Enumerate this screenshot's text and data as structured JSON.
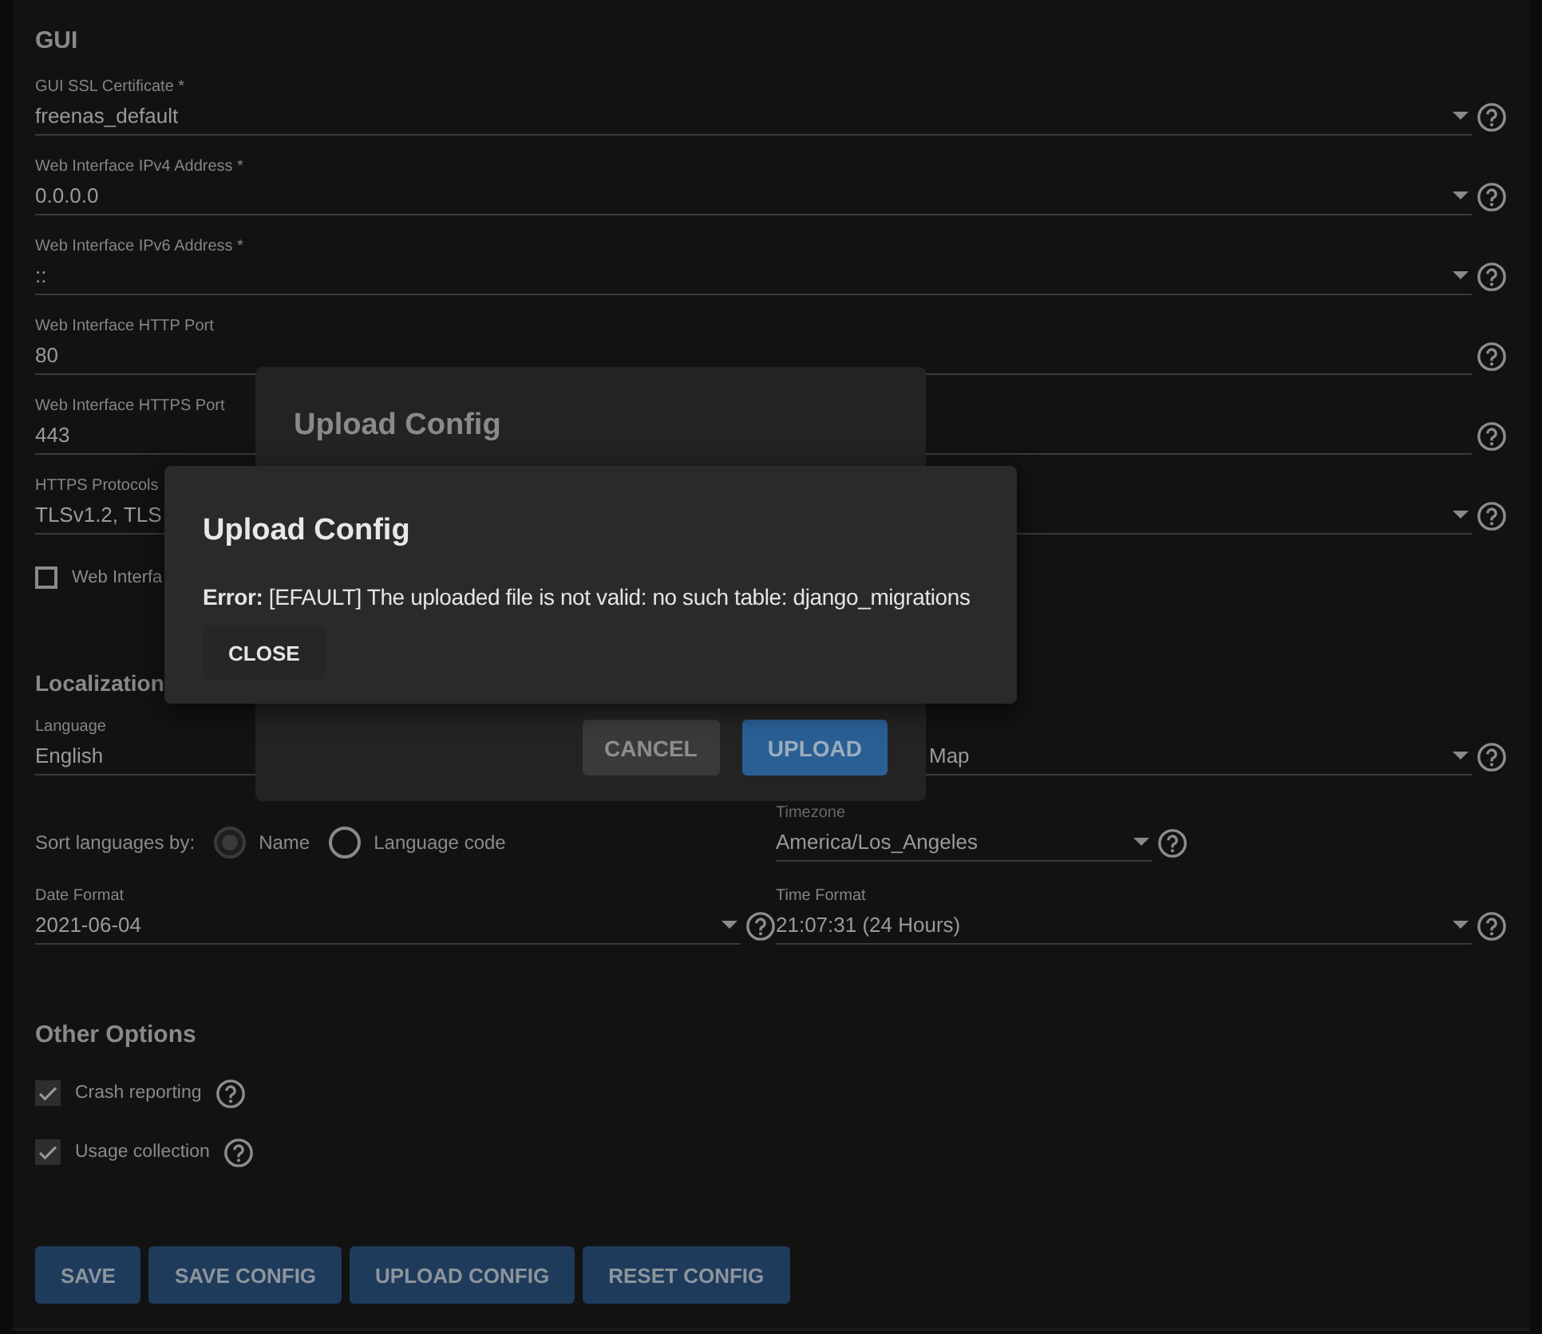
{
  "gui": {
    "title": "GUI",
    "fields": [
      {
        "kind": "select",
        "label": "GUI SSL Certificate *",
        "value": "freenas_default"
      },
      {
        "kind": "select",
        "label": "Web Interface IPv4 Address *",
        "value": "0.0.0.0"
      },
      {
        "kind": "select",
        "label": "Web Interface IPv6 Address *",
        "value": "::"
      },
      {
        "kind": "input",
        "label": "Web Interface HTTP Port",
        "value": "80"
      },
      {
        "kind": "input",
        "label": "Web Interface HTTPS Port",
        "value": "443"
      },
      {
        "kind": "select",
        "label": "HTTPS Protocols",
        "value": "TLSv1.2, TLS"
      }
    ],
    "checkbox": {
      "label": "Web Interfa",
      "checked": false
    }
  },
  "localization": {
    "title": "Localization",
    "language": {
      "label": "Language",
      "value": "English"
    },
    "keyboard_map": {
      "value": "Map"
    },
    "sort": {
      "label": "Sort languages by:",
      "options": [
        {
          "label": "Name",
          "selected": true
        },
        {
          "label": "Language code",
          "selected": false
        }
      ]
    },
    "timezone": {
      "label": "Timezone",
      "value": "America/Los_Angeles"
    },
    "date_format": {
      "label": "Date Format",
      "value": "2021-06-04"
    },
    "time_format": {
      "label": "Time Format",
      "value": "21:07:31 (24 Hours)"
    }
  },
  "other_options": {
    "title": "Other Options",
    "items": [
      {
        "label": "Crash reporting",
        "checked": true
      },
      {
        "label": "Usage collection",
        "checked": true
      }
    ]
  },
  "buttons": [
    "SAVE",
    "SAVE CONFIG",
    "UPLOAD CONFIG",
    "RESET CONFIG"
  ],
  "upload_dialog": {
    "title": "Upload Config",
    "buttons": [
      {
        "label": "CANCEL",
        "kind": "flat"
      },
      {
        "label": "UPLOAD",
        "kind": "primary"
      }
    ]
  },
  "error_dialog": {
    "title": "Upload Config",
    "message": "**Error:** [EFAULT] The uploaded file is not valid: no such table: django_migrations",
    "button": "CLOSE"
  }
}
